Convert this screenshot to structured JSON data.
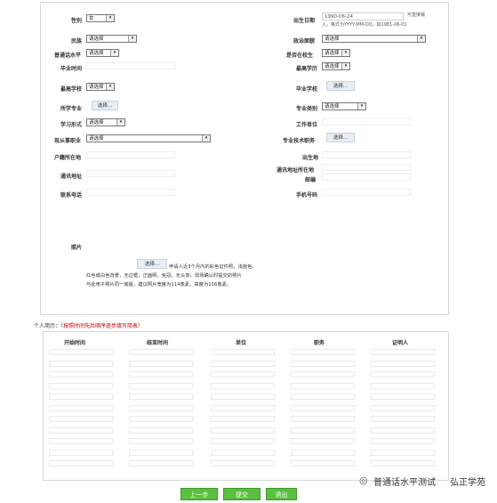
{
  "form": {
    "gender": {
      "label": "性别",
      "value": "女"
    },
    "birthdate": {
      "label": "出生日期",
      "value": "1990-06-24",
      "hint_right": "可直接输",
      "hint_line2": "入，格式为YYYY-MM-DD，如1981-06-01"
    },
    "ethnicity": {
      "label": "民族",
      "value": "请选择"
    },
    "political": {
      "label": "政治面貌",
      "value": "请选择"
    },
    "mandarin": {
      "label": "普通话水平",
      "value": "请选择"
    },
    "enrolled": {
      "label": "是否在校生",
      "value": "请选择"
    },
    "grad_time": {
      "label": "毕业时间"
    },
    "education": {
      "label": "最高学历",
      "value": "请选择"
    },
    "school": {
      "label": "最高学校",
      "value": "请选择"
    },
    "grad_school": {
      "label": "毕业学校",
      "button": "选择..."
    },
    "major": {
      "label": "所学专业",
      "button": "选择..."
    },
    "major_type": {
      "label": "专业类别",
      "value": "请选择"
    },
    "study_mode": {
      "label": "学习形式",
      "value": "请选择"
    },
    "employer": {
      "label": "工作单位"
    },
    "occupation": {
      "label": "现从事职业",
      "value": "请选择"
    },
    "title": {
      "label": "专业技术职务",
      "button": "选择..."
    },
    "hukou": {
      "label": "户籍所在地"
    },
    "birthplace": {
      "label": "出生地"
    },
    "address": {
      "label": "通讯地址"
    },
    "address_region": {
      "label": "通讯地址所在地"
    },
    "postcode": {
      "label": "邮编"
    },
    "phone": {
      "label": "联系电话"
    },
    "mobile": {
      "label": "手机号码"
    },
    "photo": {
      "label": "照片",
      "button": "选择...",
      "note_line1": "申请人近3个月内的彩色证件照，浅蓝色、",
      "note_line2": "红色或白色背景，无边框，正面照，免冠，无头饰，现场确认时提交的照片",
      "note_line3": "与此电子照片同一底版，建议照片宽度为114像素，高度为156像素。"
    }
  },
  "resume": {
    "title": "个人简历：",
    "title_note": "（按照时间先后顺序逐步填写简表）",
    "columns": [
      "开始时间",
      "结束时间",
      "单位",
      "职务",
      "证明人"
    ]
  },
  "nav": {
    "prev": "上一步",
    "submit": "提交",
    "exit": "退出"
  },
  "watermark": {
    "text": "普通话水平测试",
    "text2": "弘正学苑"
  }
}
